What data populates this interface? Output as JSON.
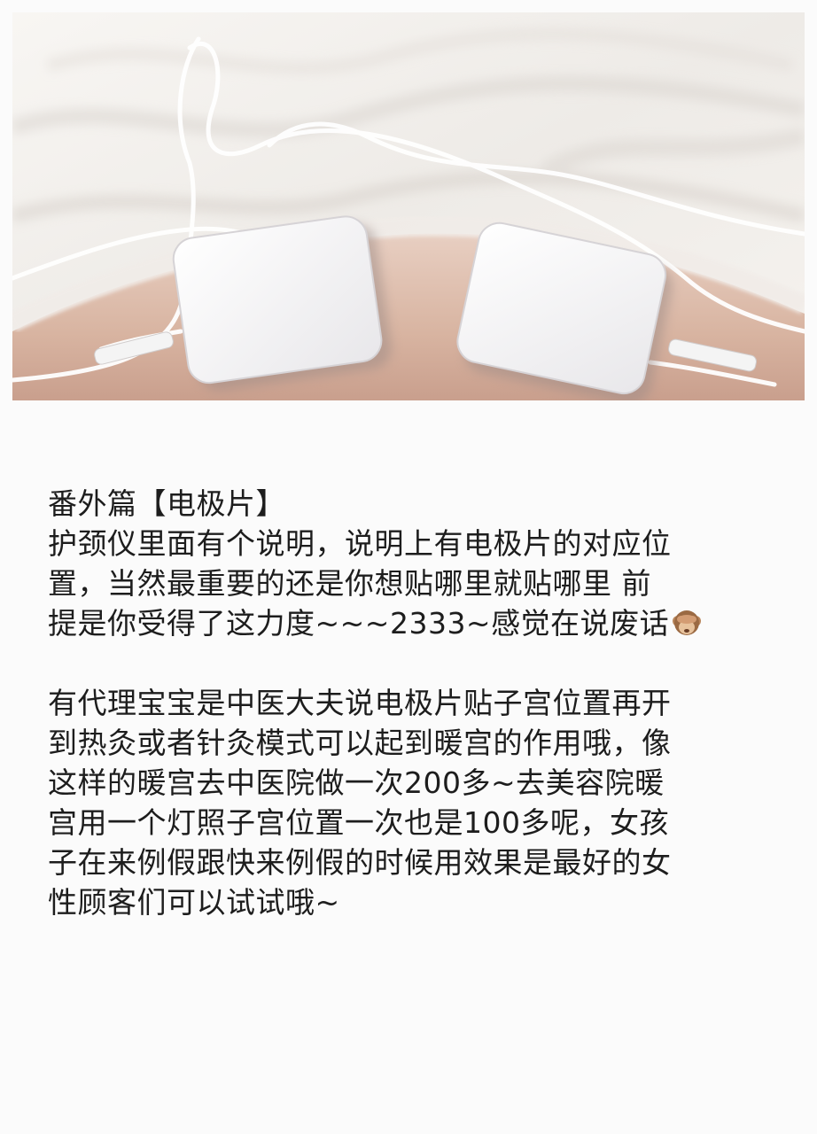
{
  "post": {
    "title": "番外篇【电极片】",
    "paragraph1": [
      "护颈仪里面有个说明，说明上有电极片的对应位",
      "置，当然最重要的还是你想贴哪里就贴哪里 前",
      "提是你受得了这力度~~~2333~感觉在说废话"
    ],
    "paragraph1_end_emoji": "see-no-evil-monkey-icon",
    "paragraph2": [
      "有代理宝宝是中医大夫说电极片贴子宫位置再开",
      "到热灸或者针灸模式可以起到暖宫的作用哦，像",
      "这样的暖宫去中医院做一次200多~去美容院暖",
      "宫用一个灯照子宫位置一次也是100多呢，女孩",
      "子在来例假跟快来例假的时候用效果是最好的女",
      "性顾客们可以试试哦~"
    ]
  },
  "photo": {
    "icon": "electrode-pads-photo",
    "colors": {
      "fabric": "#f4f1ee",
      "skin": "#d9b8a8",
      "pad": "#f7f7f8"
    }
  }
}
